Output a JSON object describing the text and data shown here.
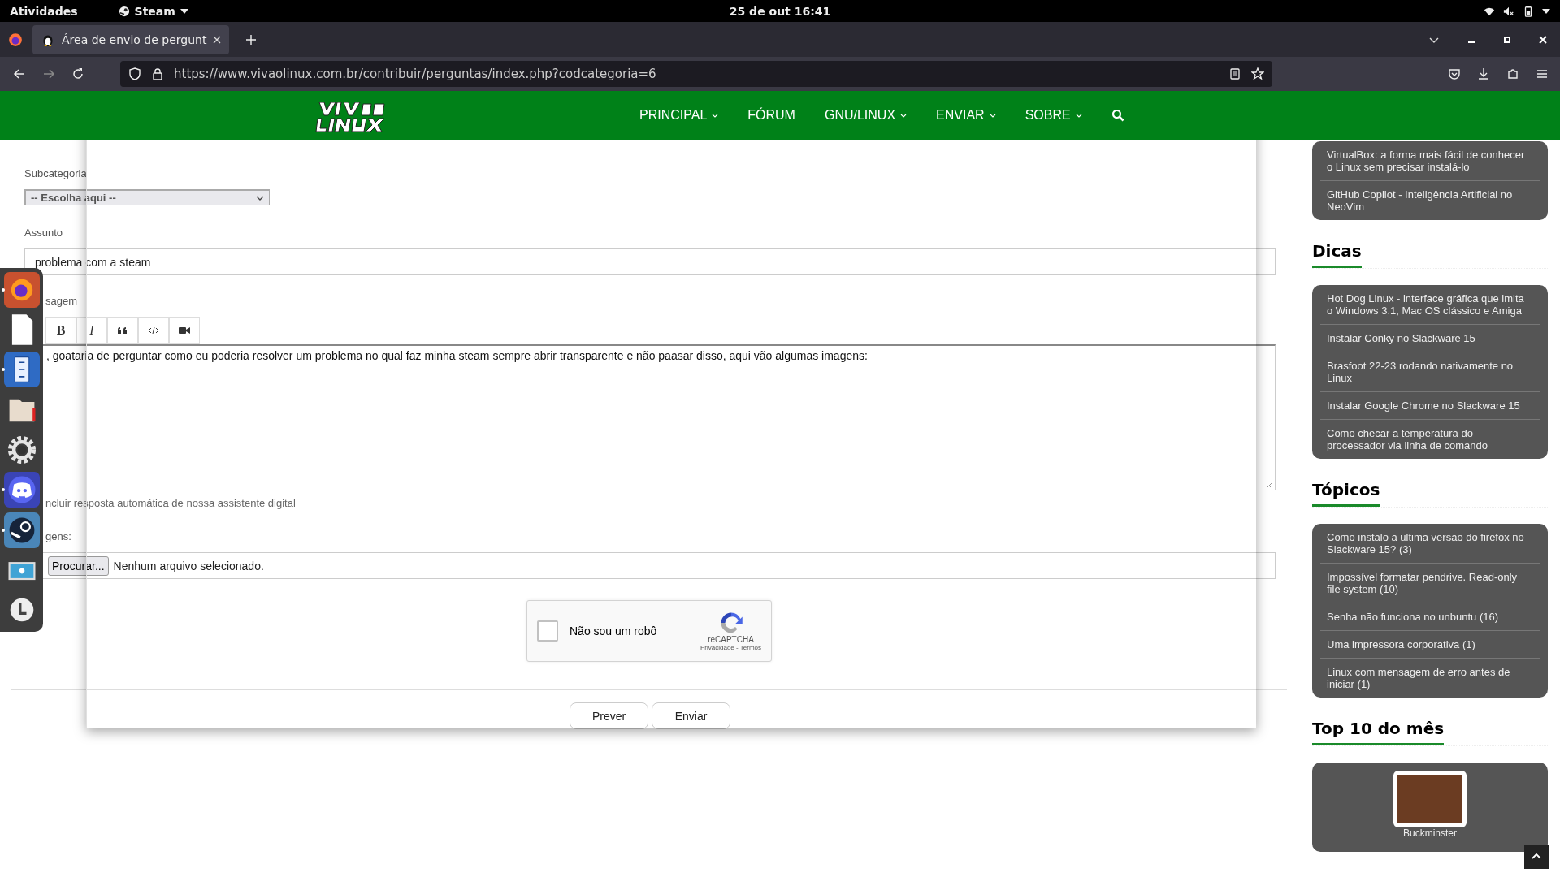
{
  "system_bar": {
    "activities": "Atividades",
    "app_menu": "Steam",
    "clock": "25 de out  16:41"
  },
  "browser": {
    "tabs": [
      {
        "title": "Área de envio de pergunt",
        "selected": true
      }
    ],
    "url": "https://www.vivaolinux.com.br/contribuir/perguntas/index.php?codcategoria=6"
  },
  "site_nav": [
    {
      "label": "PRINCIPAL",
      "dropdown": true
    },
    {
      "label": "FÓRUM",
      "dropdown": false
    },
    {
      "label": "GNU/LINUX",
      "dropdown": true
    },
    {
      "label": "ENVIAR",
      "dropdown": true
    },
    {
      "label": "SOBRE",
      "dropdown": true
    }
  ],
  "form": {
    "subcategory_label": "Subcategoria",
    "subcategory_select": "-- Escolha aqui --",
    "subject_label": "Assunto",
    "subject_value": "problema com a steam",
    "message_label": "sagem",
    "editor_tools": [
      {
        "kind": "bold",
        "label": "B"
      },
      {
        "kind": "italic",
        "label": "I"
      },
      {
        "kind": "quote"
      },
      {
        "kind": "code"
      },
      {
        "kind": "video"
      }
    ],
    "message_value": ", goataria de perguntar como eu poderia resolver um problema no qual faz minha steam sempre abrir transparente e não paasar disso, aqui vão algumas imagens:",
    "auto_reply_label": "ncluir resposta automática de nossa assistente digital",
    "images_label": "gens:",
    "file_button": "Procurar...",
    "file_status": "Nenhum arquivo selecionado.",
    "captcha": {
      "checked": false,
      "label": "Não sou um robô",
      "brand": "reCAPTCHA",
      "links": "Privacidade - Termos"
    },
    "buttons": [
      "Prever",
      "Enviar"
    ]
  },
  "sidebar": [
    {
      "items": [
        "VirtualBox: a forma mais fácil de conhecer o Linux sem precisar instalá-lo",
        "GitHub Copilot - Inteligência Artificial no NeoVim"
      ]
    },
    {
      "title": "Dicas",
      "items": [
        "Hot Dog Linux - interface gráfica que imita o Windows 3.1, Mac OS clássico e Amiga",
        "Instalar Conky no Slackware 15",
        "Brasfoot 22-23 rodando nativamente no Linux",
        "Instalar Google Chrome no Slackware 15",
        "Como checar a temperatura do processador via linha de comando"
      ]
    },
    {
      "title": "Tópicos",
      "items": [
        "Como instalo a ultima versão do firefox no Slackware 15? (3)",
        "Impossível formatar pendrive. Read-only file system (10)",
        "Senha não funciona no unbuntu (16)",
        "Uma impressora corporativa (1)",
        "Linux com mensagem de erro antes de iniciar (1)"
      ]
    },
    {
      "title": "Top 10 do mês",
      "members": [
        "Buckminster"
      ]
    }
  ],
  "dock": [
    {
      "kind": "firefox",
      "running": true
    },
    {
      "kind": "document",
      "running": false
    },
    {
      "kind": "files",
      "running": true
    },
    {
      "kind": "folder",
      "running": false
    },
    {
      "kind": "settings",
      "running": false
    },
    {
      "kind": "discord",
      "running": true
    },
    {
      "kind": "steam",
      "running": true
    },
    {
      "kind": "screenshot",
      "running": false
    },
    {
      "kind": "clock",
      "running": false
    }
  ]
}
